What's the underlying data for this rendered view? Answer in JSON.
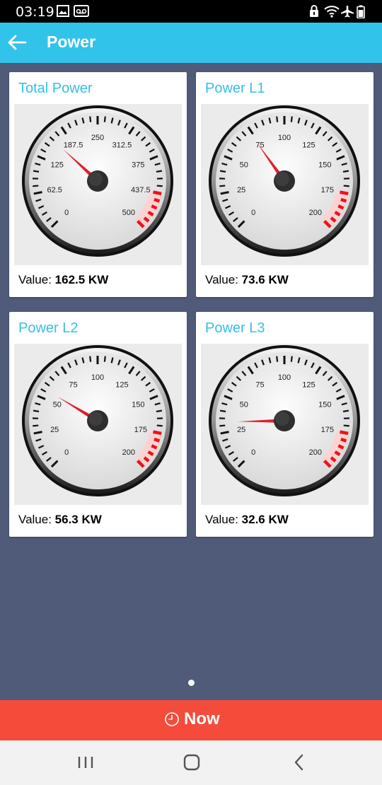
{
  "status_bar": {
    "time": "03:19",
    "left_icons": [
      "image-icon",
      "voicemail-icon"
    ],
    "right_icons": [
      "alarm-lock-icon",
      "wifi-icon",
      "airplane-mode-icon",
      "battery-icon"
    ]
  },
  "app_bar": {
    "back_icon": "arrow-left-icon",
    "title": "Power"
  },
  "value_prefix": "Value: ",
  "gauges": [
    {
      "title": "Total Power",
      "value_text": "162.5 KW",
      "value": 162.5,
      "max": 500,
      "labels": [
        "0",
        "62.5",
        "125",
        "187.5",
        "250",
        "312.5",
        "375",
        "437.5",
        "500"
      ]
    },
    {
      "title": "Power L1",
      "value_text": "73.6 KW",
      "value": 73.6,
      "max": 200,
      "labels": [
        "0",
        "25",
        "50",
        "75",
        "100",
        "125",
        "150",
        "175",
        "200"
      ]
    },
    {
      "title": "Power L2",
      "value_text": "56.3 KW",
      "value": 56.3,
      "max": 200,
      "labels": [
        "0",
        "25",
        "50",
        "75",
        "100",
        "125",
        "150",
        "175",
        "200"
      ]
    },
    {
      "title": "Power L3",
      "value_text": "32.6 KW",
      "value": 32.6,
      "max": 200,
      "labels": [
        "0",
        "25",
        "50",
        "75",
        "100",
        "125",
        "150",
        "175",
        "200"
      ]
    }
  ],
  "pager": {
    "pages": 1,
    "current": 1
  },
  "now_button": {
    "icon": "clock-icon",
    "label": "Now"
  },
  "nav_bar": {
    "icons": [
      "recent-apps-icon",
      "home-icon",
      "back-nav-icon"
    ]
  },
  "colors": {
    "app_bar": "#31c3ea",
    "card_title": "#35c0e6",
    "background": "#4f5b78",
    "now_bar": "#f44b3b",
    "needle": "#e0202a",
    "red_zone": "#e8151b"
  }
}
